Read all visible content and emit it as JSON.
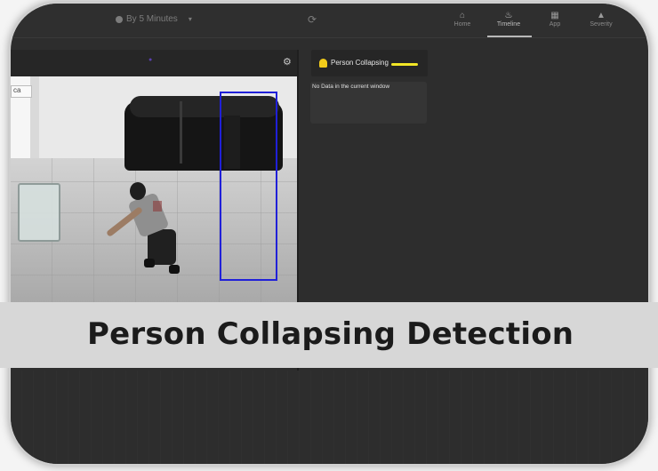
{
  "topbar": {
    "interval_label": "By 5 Minutes",
    "interval_caret": "▾",
    "refresh_glyph": "⟳",
    "nav": [
      {
        "label": "Home",
        "icon": "home-icon",
        "glyph": "⌂",
        "active": false
      },
      {
        "label": "Timeline",
        "icon": "timeline-icon",
        "glyph": "♨",
        "active": true
      },
      {
        "label": "App",
        "icon": "app-grid-icon",
        "glyph": "▦",
        "active": false
      },
      {
        "label": "Severity",
        "icon": "warning-icon",
        "glyph": "▲",
        "active": false
      }
    ]
  },
  "camera": {
    "gear_glyph": "⚙",
    "partial_label": "ca"
  },
  "alert": {
    "label": "Person Collapsing",
    "accent_color": "#f2e626",
    "bell_color": "#f2cc1a"
  },
  "panel": {
    "no_data_text": "No Data in the current window"
  },
  "banner": {
    "title": "Person Collapsing Detection"
  },
  "colors": {
    "bbox": "#2020d8",
    "background": "#2d2d2d"
  }
}
